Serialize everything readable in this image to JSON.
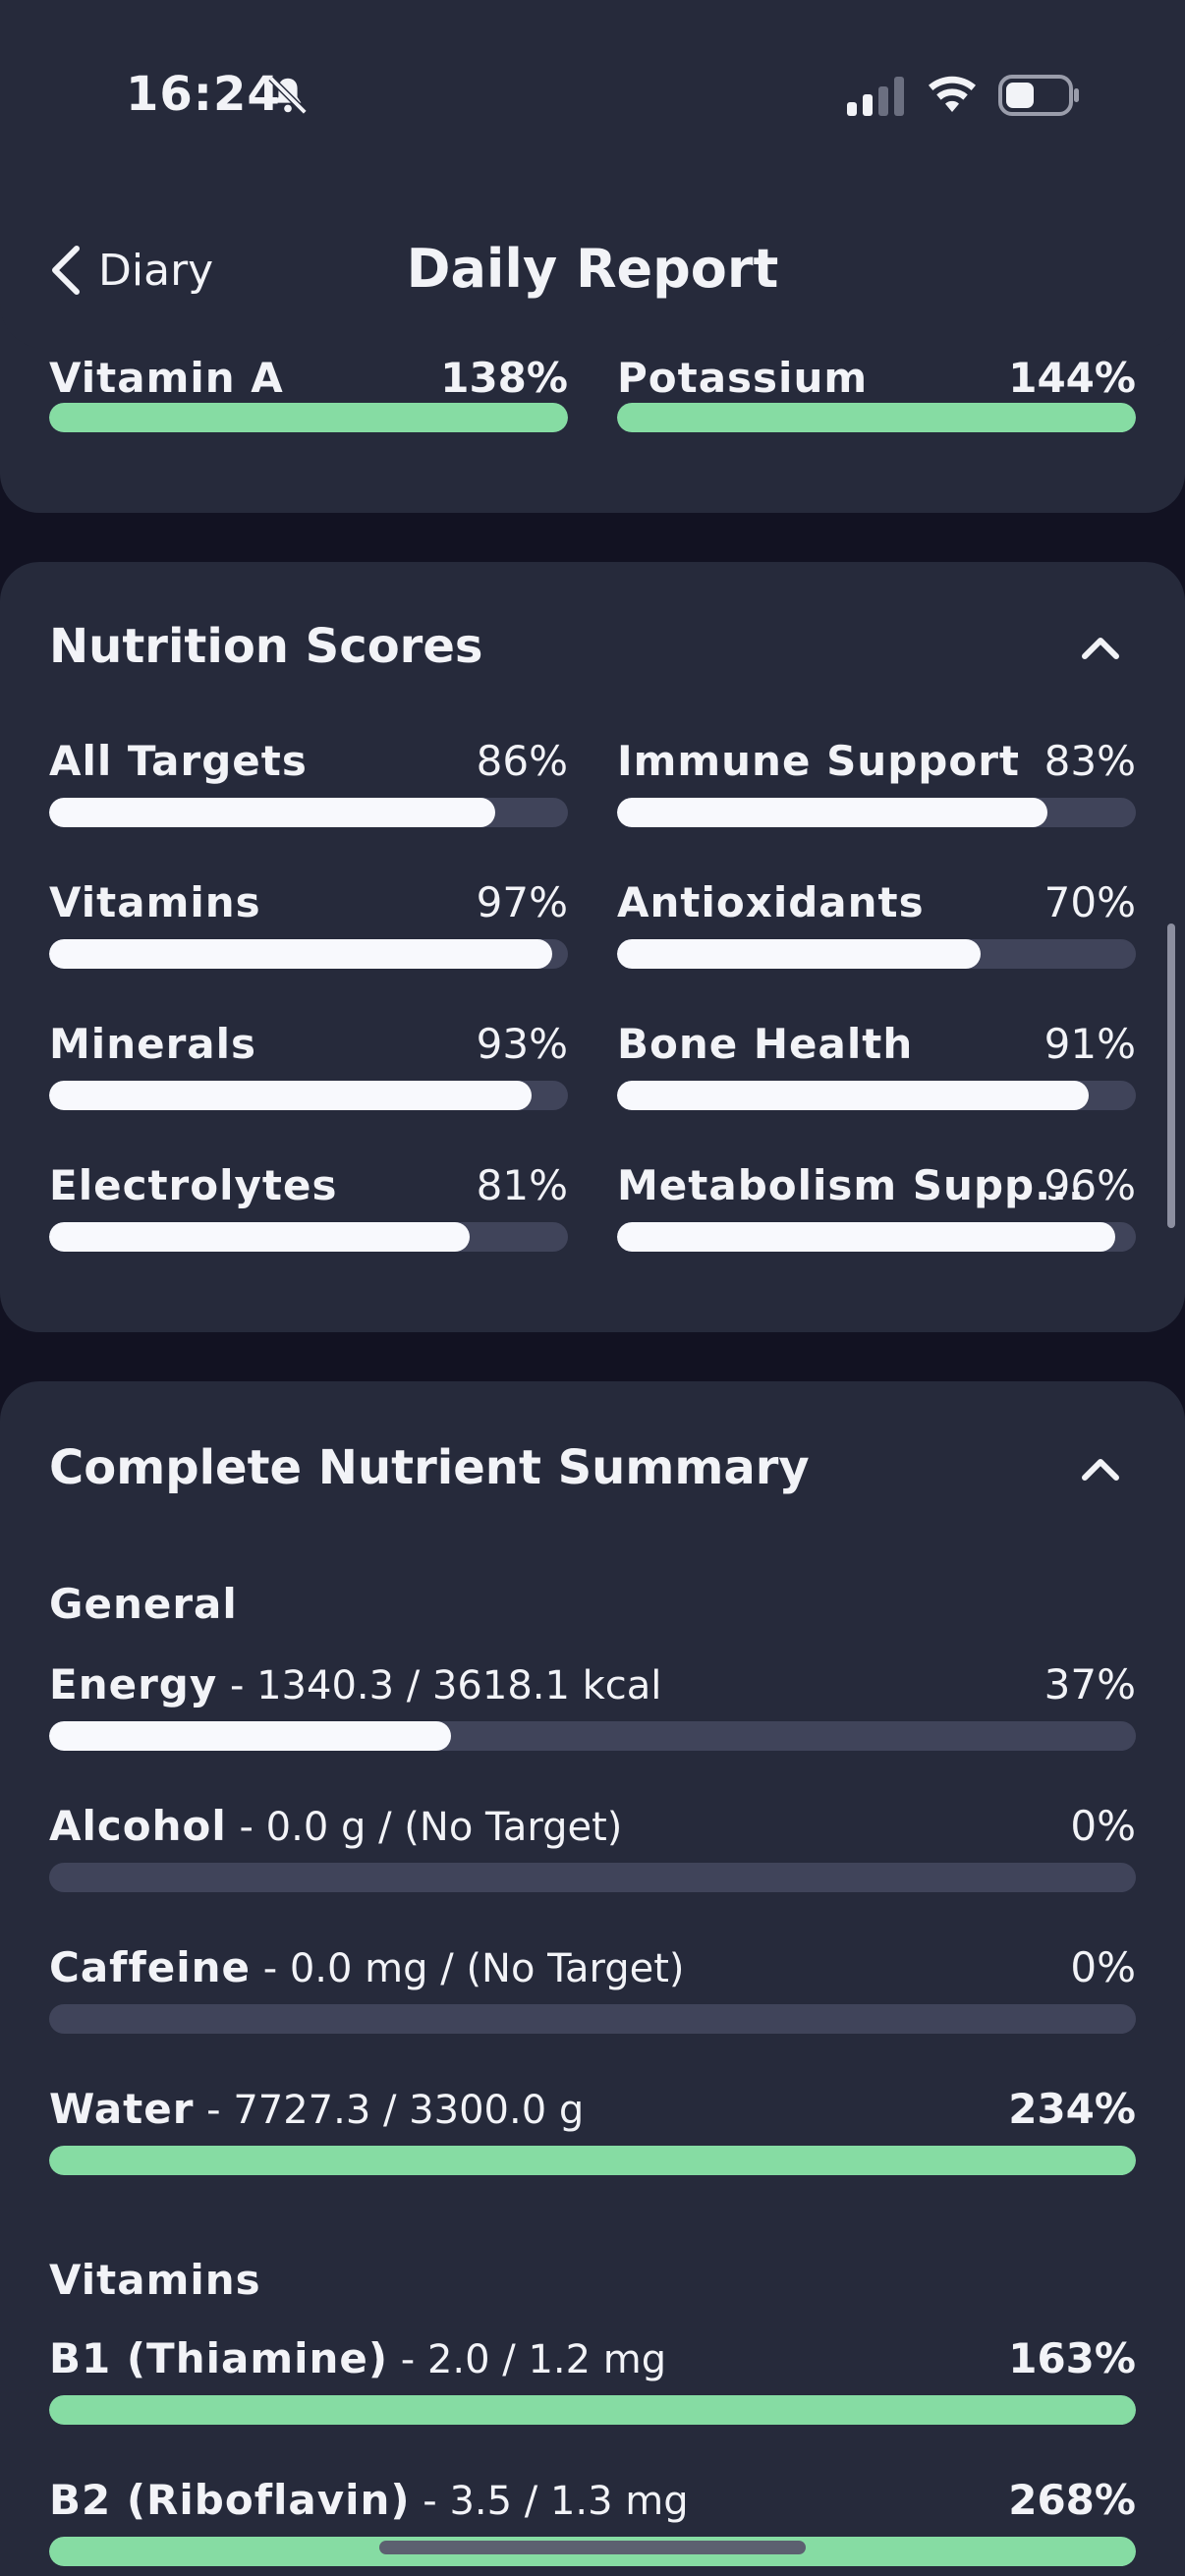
{
  "status_bar": {
    "time": "16:24",
    "icons": [
      "bell-slash-icon",
      "signal-icon",
      "wifi-icon",
      "battery-icon"
    ]
  },
  "nav": {
    "back_label": "Diary",
    "title": "Daily Report"
  },
  "top_card": {
    "items": [
      {
        "label": "Vitamin A",
        "value": "138%",
        "fraction": 1.0,
        "color": "green"
      },
      {
        "label": "Potassium",
        "value": "144%",
        "fraction": 1.0,
        "color": "green"
      }
    ]
  },
  "scores": {
    "title": "Nutrition Scores",
    "items": [
      {
        "label": "All Targets",
        "value": "86%",
        "fraction": 0.86
      },
      {
        "label": "Immune Support",
        "value": "83%",
        "fraction": 0.83
      },
      {
        "label": "Vitamins",
        "value": "97%",
        "fraction": 0.97
      },
      {
        "label": "Antioxidants",
        "value": "70%",
        "fraction": 0.7
      },
      {
        "label": "Minerals",
        "value": "93%",
        "fraction": 0.93
      },
      {
        "label": "Bone Health",
        "value": "91%",
        "fraction": 0.91
      },
      {
        "label": "Electrolytes",
        "value": "81%",
        "fraction": 0.81
      },
      {
        "label": "Metabolism Supp...",
        "value": "96%",
        "fraction": 0.96
      }
    ]
  },
  "summary": {
    "title": "Complete Nutrient Summary",
    "general": {
      "label": "General",
      "rows": [
        {
          "name": "Energy",
          "detail": " - 1340.3 / 3618.1 kcal",
          "value": "37%",
          "fraction": 0.37,
          "color": "white"
        },
        {
          "name": "Alcohol",
          "detail": " - 0.0 g / (No Target)",
          "value": "0%",
          "fraction": 0,
          "color": "white"
        },
        {
          "name": "Caffeine",
          "detail": " - 0.0 mg / (No Target)",
          "value": "0%",
          "fraction": 0,
          "color": "white"
        },
        {
          "name": "Water",
          "detail": " - 7727.3 / 3300.0 g",
          "value": "234%",
          "fraction": 1.0,
          "color": "green"
        }
      ]
    },
    "vitamins": {
      "label": "Vitamins",
      "rows": [
        {
          "name": "B1 (Thiamine)",
          "detail": " - 2.0 / 1.2 mg",
          "value": "163%",
          "fraction": 1.0,
          "color": "green"
        },
        {
          "name": "B2 (Riboflavin)",
          "detail": " - 3.5 / 1.3 mg",
          "value": "268%",
          "fraction": 1.0,
          "color": "green"
        }
      ]
    }
  },
  "colors": {
    "background": "#121222",
    "card": "#262a3b",
    "track": "#40445a",
    "fill_white": "#f8f9fd",
    "fill_green": "#86dca3"
  }
}
